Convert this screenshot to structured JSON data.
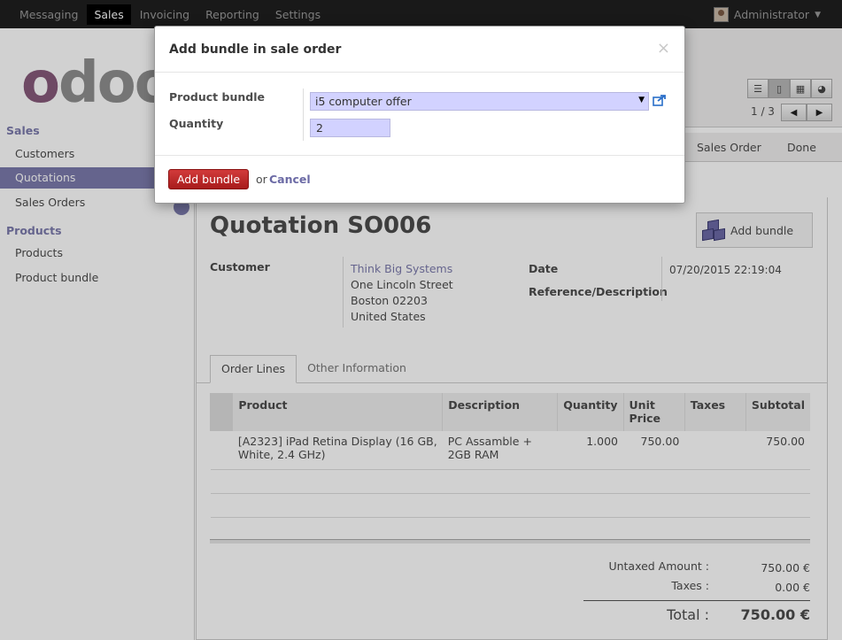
{
  "topbar": {
    "menu": [
      "Messaging",
      "Sales",
      "Invoicing",
      "Reporting",
      "Settings"
    ],
    "active": "Sales",
    "user": "Administrator"
  },
  "sidebar": {
    "sections": [
      {
        "title": "Sales",
        "items": [
          "Customers",
          "Quotations",
          "Sales Orders"
        ]
      },
      {
        "title": "Products",
        "items": [
          "Products",
          "Product bundle"
        ]
      }
    ],
    "active_item": "Quotations"
  },
  "control_panel": {
    "pager": "1 / 3",
    "view_icons": [
      "list-view-icon",
      "form-view-icon",
      "calendar-view-icon",
      "graph-view-icon"
    ]
  },
  "statusbar": {
    "stages": [
      "Sales Order",
      "Done"
    ]
  },
  "record": {
    "title": "Quotation SO006",
    "add_bundle_button": "Add bundle",
    "customer_label": "Customer",
    "customer_name": "Think Big Systems",
    "address": [
      "One Lincoln Street",
      "Boston 02203",
      "United States"
    ],
    "date_label": "Date",
    "date_value": "07/20/2015 22:19:04",
    "reference_label": "Reference/Description"
  },
  "tabs": [
    "Order Lines",
    "Other Information"
  ],
  "order_lines": {
    "headers": {
      "product": "Product",
      "description": "Description",
      "quantity": "Quantity",
      "unit_price": "Unit Price",
      "taxes": "Taxes",
      "subtotal": "Subtotal"
    },
    "rows": [
      {
        "product": "[A2323] iPad Retina Display (16 GB, White, 2.4 GHz)",
        "description": "PC Assamble + 2GB RAM",
        "quantity": "1.000",
        "unit_price": "750.00",
        "taxes": "",
        "subtotal": "750.00"
      }
    ]
  },
  "totals": {
    "untaxed_label": "Untaxed Amount :",
    "untaxed_value": "750.00 €",
    "taxes_label": "Taxes :",
    "taxes_value": "0.00 €",
    "total_label": "Total :",
    "total_value": "750.00 €"
  },
  "dialog": {
    "title": "Add bundle in sale order",
    "close": "×",
    "bundle_label": "Product bundle",
    "bundle_value": "i5 computer offer",
    "quantity_label": "Quantity",
    "quantity_value": "2",
    "primary_button": "Add bundle",
    "or_text": "or",
    "cancel": "Cancel"
  },
  "colors": {
    "accent": "#7c7bad",
    "primary_button": "#c42c2c",
    "logo_purple": "#875a7b"
  }
}
